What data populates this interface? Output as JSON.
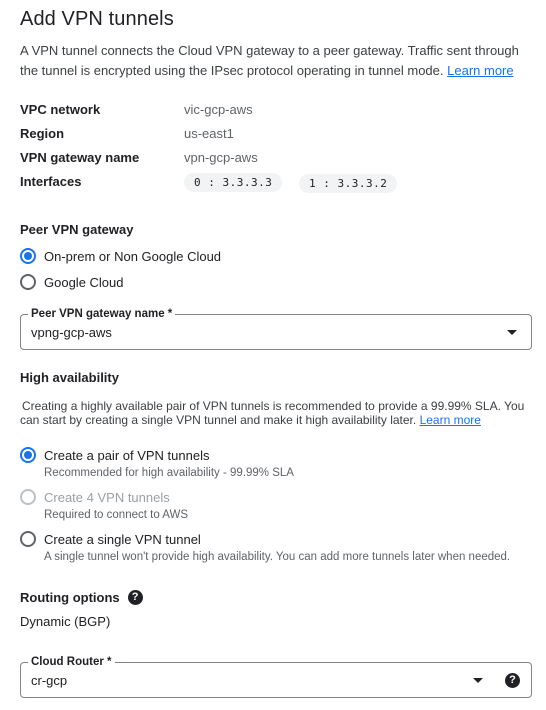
{
  "page": {
    "title": "Add VPN tunnels",
    "intro_text_1": "A VPN tunnel connects the Cloud VPN gateway to a peer gateway. Traffic sent through",
    "intro_text_2": "the tunnel is encrypted using the IPsec protocol operating in tunnel mode.",
    "intro_link": "Learn more"
  },
  "details": {
    "vpc_network_label": "VPC network",
    "vpc_network_value": "vic-gcp-aws",
    "region_label": "Region",
    "region_value": "us-east1",
    "gateway_name_label": "VPN gateway name",
    "gateway_name_value": "vpn-gcp-aws",
    "interfaces_label": "Interfaces",
    "interfaces": [
      "0 : 3.3.3.3",
      "1 : 3.3.3.2"
    ]
  },
  "peer_gateway": {
    "heading": "Peer VPN gateway",
    "options": [
      {
        "label": "On-prem or Non Google Cloud",
        "selected": true
      },
      {
        "label": "Google Cloud",
        "selected": false
      }
    ],
    "name_field": {
      "label": "Peer VPN gateway name *",
      "value": "vpng-gcp-aws"
    }
  },
  "high_availability": {
    "heading": "High availability",
    "desc_1": "Creating a highly available pair of VPN tunnels is recommended to provide a 99.99% SLA. You",
    "desc_2": "can start by creating a single VPN tunnel and make it high availability later.",
    "desc_link": "Learn more",
    "options": [
      {
        "label": "Create a pair of VPN tunnels",
        "hint": "Recommended for high availability - 99.99% SLA",
        "selected": true,
        "disabled": false
      },
      {
        "label": "Create 4 VPN tunnels",
        "hint": "Required to connect to AWS",
        "selected": false,
        "disabled": true
      },
      {
        "label": "Create a single VPN tunnel",
        "hint": "A single tunnel won't provide high availability. You can add more tunnels later when needed.",
        "selected": false,
        "disabled": false
      }
    ]
  },
  "routing": {
    "heading": "Routing options",
    "value": "Dynamic (BGP)",
    "cloud_router": {
      "label": "Cloud Router *",
      "value": "cr-gcp"
    }
  },
  "colors": {
    "accent": "#1a73e8",
    "text": "#202124",
    "secondary_text": "#5f6368"
  }
}
